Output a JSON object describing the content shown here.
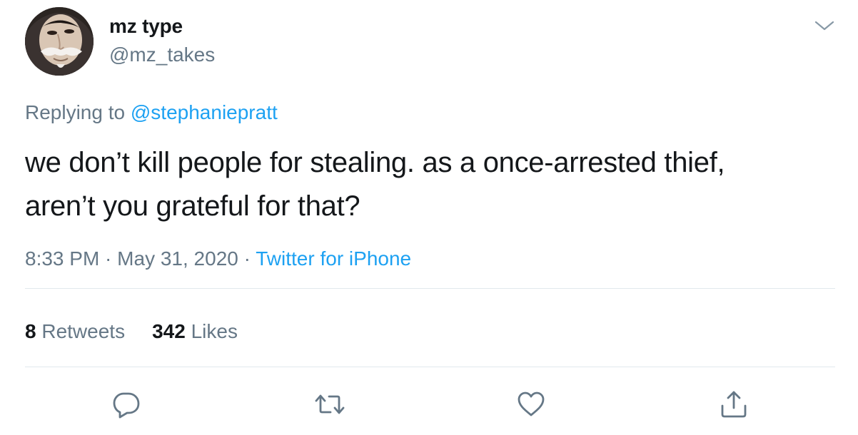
{
  "user": {
    "display_name": "mz type",
    "handle": "@mz_takes"
  },
  "reply": {
    "prefix": "Replying to ",
    "mention": "@stephaniepratt"
  },
  "tweet": {
    "line1": "we don’t kill people for stealing. as a once-arrested thief,",
    "line2": "aren’t you grateful for that?"
  },
  "meta": {
    "time": "8:33 PM",
    "sep1": " · ",
    "date": "May 31, 2020",
    "sep2": " · ",
    "source": "Twitter for iPhone"
  },
  "stats": {
    "retweets_count": "8",
    "retweets_label": " Retweets",
    "likes_count": "342",
    "likes_label": " Likes"
  },
  "actions": [
    {
      "icon": "reply-icon"
    },
    {
      "icon": "retweet-icon"
    },
    {
      "icon": "like-icon"
    },
    {
      "icon": "share-icon"
    }
  ],
  "colors": {
    "accent": "#1da1f2",
    "secondary_text": "#657786",
    "primary_text": "#14171a",
    "divider": "#e1e8ed"
  }
}
